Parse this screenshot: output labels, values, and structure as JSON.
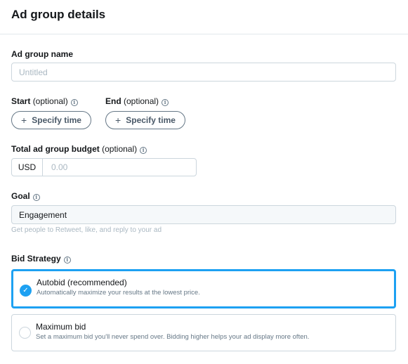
{
  "header": {
    "title": "Ad group details"
  },
  "name_field": {
    "label": "Ad group name",
    "placeholder": "Untitled"
  },
  "start": {
    "label": "Start",
    "optional": "(optional)",
    "button": "Specify time"
  },
  "end": {
    "label": "End",
    "optional": "(optional)",
    "button": "Specify time"
  },
  "budget": {
    "label": "Total ad group budget",
    "optional": "(optional)",
    "currency": "USD",
    "placeholder": "0.00"
  },
  "goal": {
    "label": "Goal",
    "value": "Engagement",
    "helper": "Get people to Retweet, like, and reply to your ad"
  },
  "bid_strategy": {
    "label": "Bid Strategy",
    "options": [
      {
        "title": "Autobid (recommended)",
        "description": "Automatically maximize your results at the lowest price.",
        "selected": true
      },
      {
        "title": "Maximum bid",
        "description": "Set a maximum bid you'll never spend over. Bidding higher helps your ad display more often.",
        "selected": false
      }
    ]
  },
  "icons": {
    "info": "info-icon",
    "plus": "plus-icon",
    "check": "checkmark-icon"
  },
  "colors": {
    "accent": "#1da1f2",
    "border": "#ccd6dd",
    "muted": "#657786"
  }
}
